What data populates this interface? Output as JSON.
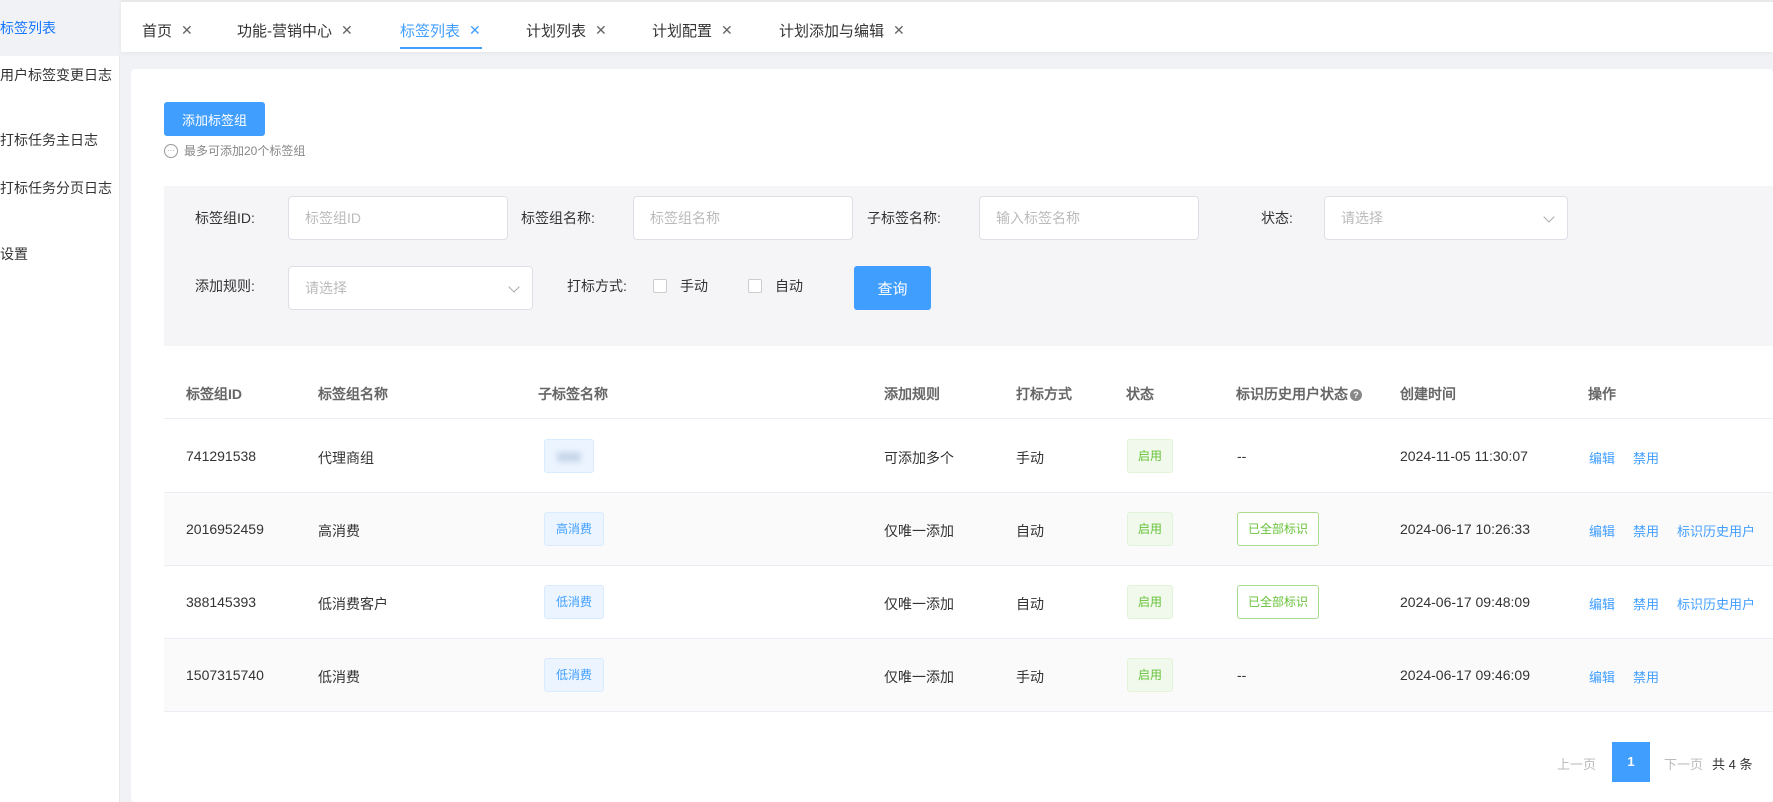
{
  "sidebar": {
    "items": [
      {
        "label": "标签列表"
      },
      {
        "label": "用户标签变更日志"
      },
      {
        "label": "打标任务主日志"
      },
      {
        "label": "打标任务分页日志"
      },
      {
        "label": "设置"
      }
    ]
  },
  "tabs": [
    {
      "label": "首页"
    },
    {
      "label": "功能-营销中心"
    },
    {
      "label": "标签列表"
    },
    {
      "label": "计划列表"
    },
    {
      "label": "计划配置"
    },
    {
      "label": "计划添加与编辑"
    }
  ],
  "toolbar": {
    "add_label": "添加标签组",
    "hint": "最多可添加20个标签组"
  },
  "filter": {
    "group_id_label": "标签组ID:",
    "group_id_placeholder": "标签组ID",
    "group_name_label": "标签组名称:",
    "group_name_placeholder": "标签组名称",
    "sub_name_label": "子标签名称:",
    "sub_name_placeholder": "输入标签名称",
    "status_label": "状态:",
    "status_placeholder": "请选择",
    "rule_label": "添加规则:",
    "rule_placeholder": "请选择",
    "method_label": "打标方式:",
    "manual_label": "手动",
    "auto_label": "自动",
    "query_label": "查询"
  },
  "table": {
    "headers": [
      "标签组ID",
      "标签组名称",
      "子标签名称",
      "添加规则",
      "打标方式",
      "状态",
      "标识历史用户状态",
      "创建时间",
      "操作"
    ],
    "rows": [
      {
        "id": "741291538",
        "name": "代理商组",
        "sub": "",
        "rule": "可添加多个",
        "method": "手动",
        "status": "启用",
        "history": "--",
        "created": "2024-11-05 11:30:07",
        "op_edit": "编辑",
        "op_disable": "禁用",
        "op_history": ""
      },
      {
        "id": "2016952459",
        "name": "高消费",
        "sub": "高消费",
        "rule": "仅唯一添加",
        "method": "自动",
        "status": "启用",
        "history": "已全部标识",
        "created": "2024-06-17 10:26:33",
        "op_edit": "编辑",
        "op_disable": "禁用",
        "op_history": "标识历史用户"
      },
      {
        "id": "388145393",
        "name": "低消费客户",
        "sub": "低消费",
        "rule": "仅唯一添加",
        "method": "自动",
        "status": "启用",
        "history": "已全部标识",
        "created": "2024-06-17 09:48:09",
        "op_edit": "编辑",
        "op_disable": "禁用",
        "op_history": "标识历史用户"
      },
      {
        "id": "1507315740",
        "name": "低消费",
        "sub": "低消费",
        "rule": "仅唯一添加",
        "method": "手动",
        "status": "启用",
        "history": "--",
        "created": "2024-06-17 09:46:09",
        "op_edit": "编辑",
        "op_disable": "禁用",
        "op_history": ""
      }
    ]
  },
  "pagination": {
    "prev": "上一页",
    "current": "1",
    "next": "下一页",
    "total": "共 4 条"
  },
  "colors": {
    "accent": "#409eff",
    "success": "#67c23a"
  }
}
